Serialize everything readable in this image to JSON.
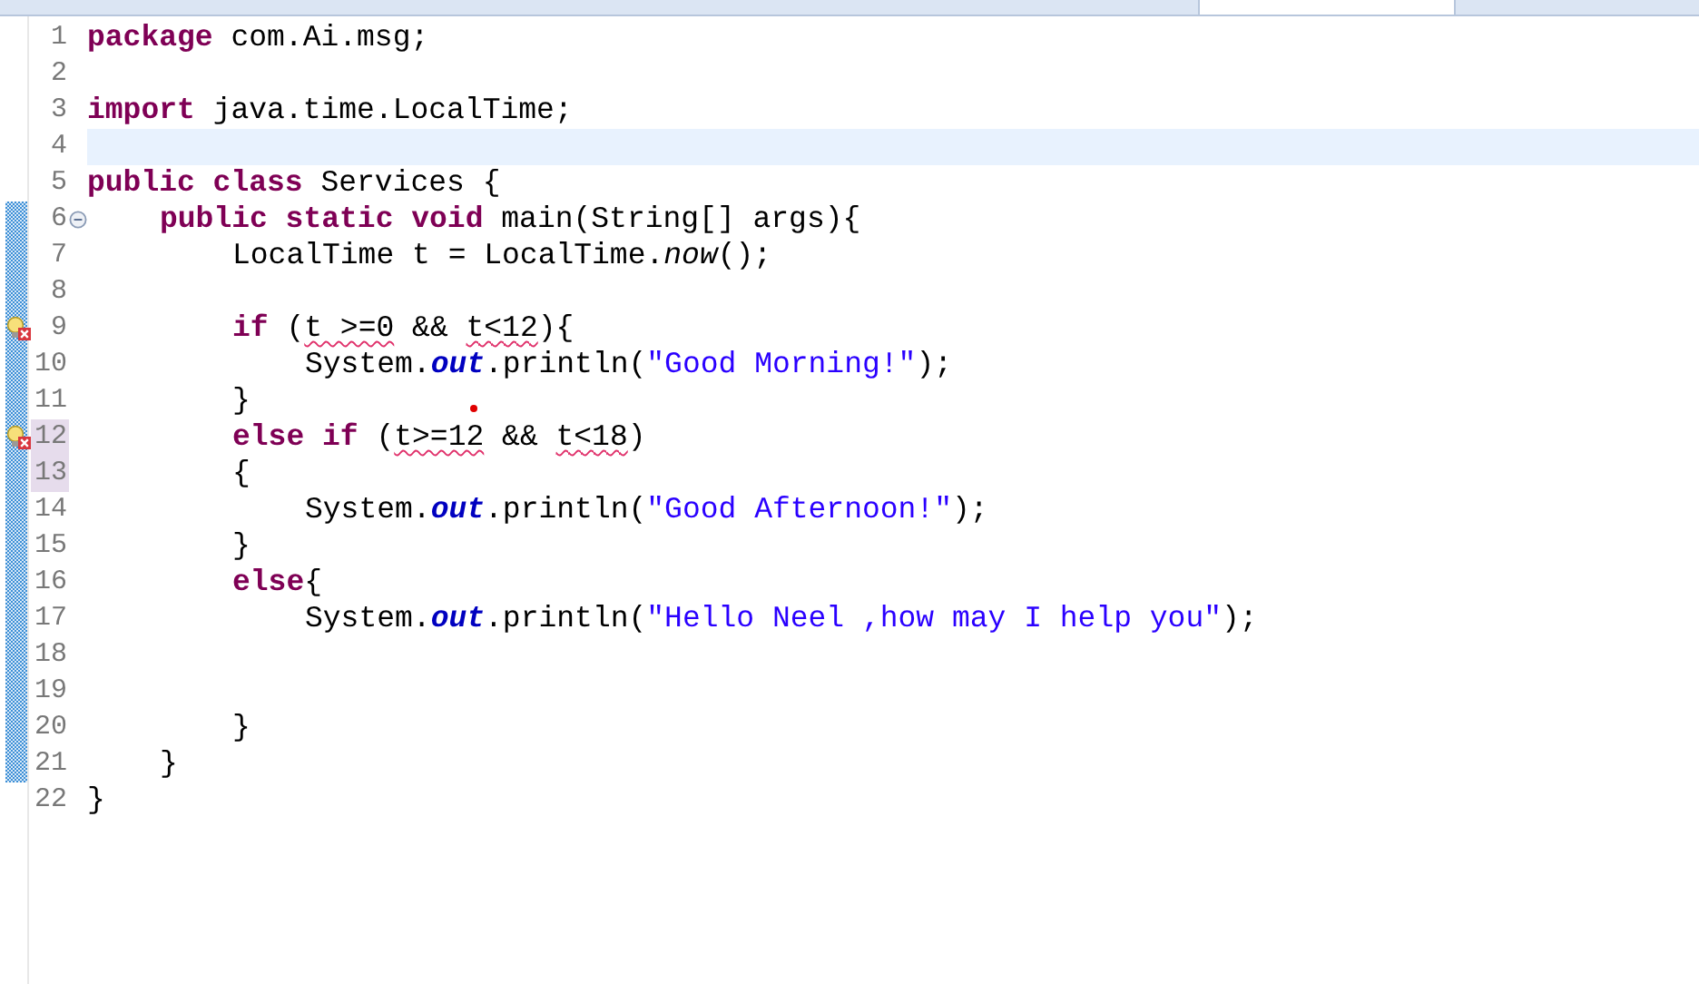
{
  "lines": [
    {
      "number": "1",
      "tokens": [
        {
          "kind": "kw",
          "text": "package"
        },
        {
          "kind": "plain",
          "text": " com.Ai.msg;"
        }
      ]
    },
    {
      "number": "2"
    },
    {
      "number": "3",
      "tokens": [
        {
          "kind": "kw",
          "text": "import"
        },
        {
          "kind": "plain",
          "text": " java.time.LocalTime;"
        }
      ]
    },
    {
      "number": "4",
      "current": true
    },
    {
      "number": "5",
      "tokens": [
        {
          "kind": "kw",
          "text": "public class"
        },
        {
          "kind": "plain",
          "text": " Services {"
        }
      ],
      "children": [
        {
          "number": "6",
          "changed": true,
          "foldable": true,
          "tokens": [
            {
              "kind": "kw",
              "text": "public static void"
            },
            {
              "kind": "plain",
              "text": " main(String[] args){"
            }
          ],
          "children": [
            {
              "number": "7",
              "changed": true,
              "tokens": [
                {
                  "kind": "plain",
                  "text": "LocalTime t = LocalTime."
                },
                {
                  "kind": "method",
                  "text": "now"
                },
                {
                  "kind": "plain",
                  "text": "();"
                }
              ]
            },
            {
              "number": "8",
              "changed": true
            },
            {
              "number": "9",
              "changed": true,
              "problem": true,
              "tokens": [
                {
                  "kind": "kw",
                  "text": "if"
                },
                {
                  "kind": "plain",
                  "text": " ("
                },
                {
                  "kind": "error",
                  "text": "t >=0"
                },
                {
                  "kind": "plain",
                  "text": " && "
                },
                {
                  "kind": "error",
                  "text": "t<12"
                },
                {
                  "kind": "plain",
                  "text": "){"
                }
              ],
              "children": [
                {
                  "number": "10",
                  "changed": true,
                  "tokens": [
                    {
                      "kind": "plain",
                      "text": "System."
                    },
                    {
                      "kind": "field",
                      "text": "out"
                    },
                    {
                      "kind": "plain",
                      "text": ".println("
                    },
                    {
                      "kind": "str",
                      "text": "\"Good Morning!\""
                    },
                    {
                      "kind": "plain",
                      "text": ");"
                    }
                  ]
                }
              ]
            },
            {
              "number": "11",
              "changed": true,
              "dot": true,
              "tokens": [
                {
                  "kind": "plain",
                  "text": "}"
                }
              ]
            },
            {
              "number": "12",
              "changed": true,
              "problem": true,
              "highlighted": true,
              "tokens": [
                {
                  "kind": "kw",
                  "text": "else if"
                },
                {
                  "kind": "plain",
                  "text": " ("
                },
                {
                  "kind": "error",
                  "text": "t>=12"
                },
                {
                  "kind": "plain",
                  "text": " && "
                },
                {
                  "kind": "error",
                  "text": "t<18"
                },
                {
                  "kind": "plain",
                  "text": ")"
                }
              ]
            },
            {
              "number": "13",
              "changed": true,
              "highlighted": true,
              "tokens": [
                {
                  "kind": "plain",
                  "text": "{"
                }
              ],
              "children": [
                {
                  "number": "14",
                  "changed": true,
                  "tokens": [
                    {
                      "kind": "plain",
                      "text": "System."
                    },
                    {
                      "kind": "field",
                      "text": "out"
                    },
                    {
                      "kind": "plain",
                      "text": ".println("
                    },
                    {
                      "kind": "str",
                      "text": "\"Good Afternoon!\""
                    },
                    {
                      "kind": "plain",
                      "text": ");"
                    }
                  ]
                }
              ]
            },
            {
              "number": "15",
              "changed": true,
              "tokens": [
                {
                  "kind": "plain",
                  "text": "}"
                }
              ]
            },
            {
              "number": "16",
              "changed": true,
              "tokens": [
                {
                  "kind": "kw",
                  "text": "else"
                },
                {
                  "kind": "plain",
                  "text": "{"
                }
              ],
              "children": [
                {
                  "number": "17",
                  "changed": true,
                  "tokens": [
                    {
                      "kind": "plain",
                      "text": "System."
                    },
                    {
                      "kind": "field",
                      "text": "out"
                    },
                    {
                      "kind": "plain",
                      "text": ".println("
                    },
                    {
                      "kind": "str",
                      "text": "\"Hello Neel ,how may I help you\""
                    },
                    {
                      "kind": "plain",
                      "text": ");"
                    }
                  ]
                },
                {
                  "number": "18",
                  "changed": true
                },
                {
                  "number": "19",
                  "changed": true
                }
              ]
            },
            {
              "number": "20",
              "changed": true,
              "tokens": [
                {
                  "kind": "plain",
                  "text": "}"
                }
              ]
            }
          ]
        },
        {
          "number": "21",
          "changed": true,
          "tokens": [
            {
              "kind": "plain",
              "text": "}"
            }
          ]
        }
      ]
    },
    {
      "number": "22",
      "tokens": [
        {
          "kind": "plain",
          "text": "}"
        }
      ]
    }
  ]
}
